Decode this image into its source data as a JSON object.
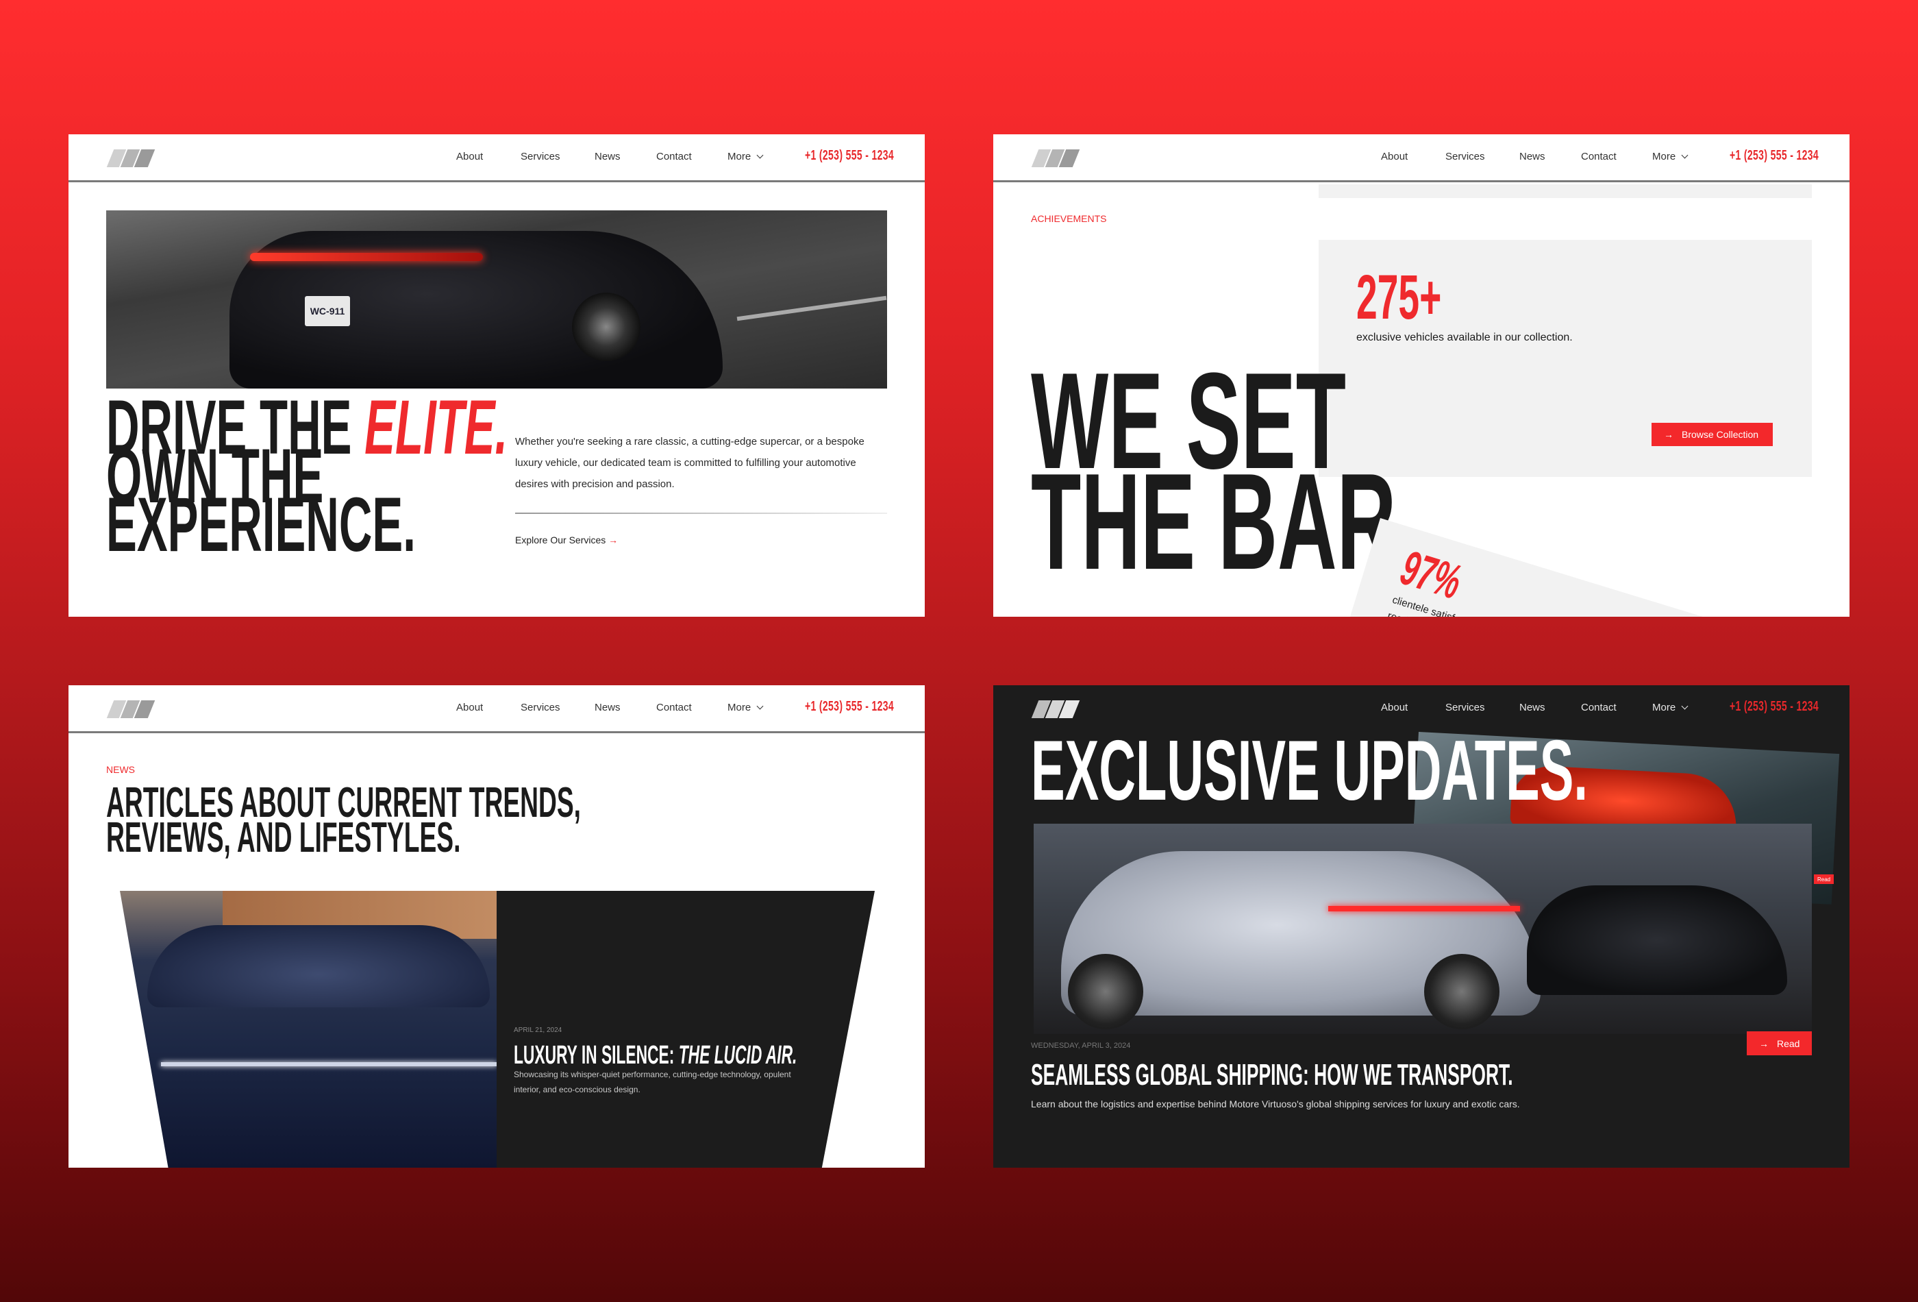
{
  "nav": {
    "items": [
      "About",
      "Services",
      "News",
      "Contact",
      "More"
    ],
    "phone": "+1 (253) 555 - 1234"
  },
  "panel1": {
    "headline_1": "DRIVE THE ",
    "headline_accent": "ELITE.",
    "headline_2": "OWN THE",
    "headline_3": "EXPERIENCE.",
    "paragraph": "Whether you're seeking a rare classic, a cutting-edge supercar, or a bespoke luxury vehicle, our dedicated team is committed to fulfilling your automotive desires with precision and passion.",
    "link": "Explore Our Services",
    "plate": "WC-911"
  },
  "panel2": {
    "eyebrow": "ACHIEVEMENTS",
    "stat_1": "275+",
    "stat_1_text": "exclusive vehicles available in our collection.",
    "button": "Browse Collection",
    "headline_1": "WE SET",
    "headline_2": "THE BAR.",
    "stat_2": "97%",
    "stat_2_text_1": "clientele satisfaction rate. Our t",
    "stat_2_text_2": "ready to assist"
  },
  "panel3": {
    "eyebrow": "NEWS",
    "heading_1": "ARTICLES ABOUT CURRENT TRENDS,",
    "heading_2": "REVIEWS, AND LIFESTYLES.",
    "article": {
      "date": "APRIL 21, 2024",
      "title_plain": "LUXURY IN SILENCE: ",
      "title_italic": "THE LUCID AIR.",
      "description": "Showcasing its whisper-quiet performance, cutting-edge technology, opulent interior, and eco-conscious design."
    }
  },
  "panel4": {
    "heading": "EXCLUSIVE UPDATES.",
    "read_small": "Read",
    "article": {
      "date": "WEDNESDAY, APRIL 3, 2024",
      "title": "SEAMLESS GLOBAL SHIPPING: HOW WE TRANSPORT.",
      "description": "Learn about the logistics and expertise behind Motore Virtuoso's global shipping services for luxury and exotic cars.",
      "read": "Read"
    }
  },
  "colors": {
    "accent": "#ef2a2d",
    "dark": "#1c1c1c",
    "card_grey": "#f2f2f2"
  }
}
